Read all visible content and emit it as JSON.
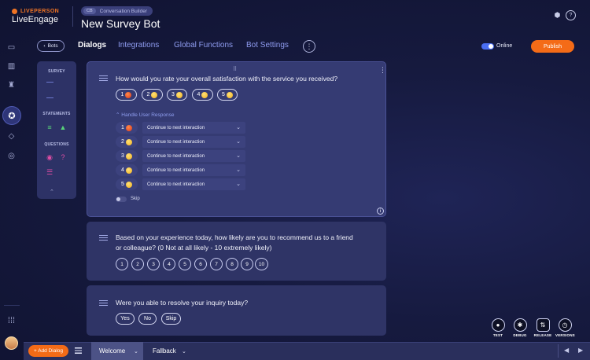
{
  "header": {
    "brand_top": "LIVEPERSON",
    "brand_name": "LiveEngage",
    "crumb_tag": "CB",
    "crumb_text": "Conversation Builder",
    "bot_title": "New Survey Bot"
  },
  "tabs": {
    "bots_label": "Bots",
    "items": [
      "Dialogs",
      "Integrations",
      "Global Functions",
      "Bot Settings"
    ],
    "status_label": "Online",
    "publish_label": "Publish"
  },
  "palette": {
    "sections": [
      "SURVEY",
      "STATEMENTS",
      "QUESTIONS"
    ]
  },
  "questions": [
    {
      "text": "How would you rate your overall satisfaction with the service you received?",
      "options": [
        "1",
        "2",
        "3",
        "4",
        "5"
      ],
      "handle_label": "Handle User Response",
      "responses": [
        {
          "num": "1",
          "action": "Continue to next interaction"
        },
        {
          "num": "2",
          "action": "Continue to next interaction"
        },
        {
          "num": "3",
          "action": "Continue to next interaction"
        },
        {
          "num": "4",
          "action": "Continue to next interaction"
        },
        {
          "num": "5",
          "action": "Continue to next interaction"
        }
      ],
      "skip_label": "Skip"
    },
    {
      "text_line1": "Based on your experience today, how likely are you to recommend us to a friend",
      "text_line2": "or colleague? (0 Not at all likely - 10 extremely likely)",
      "options": [
        "1",
        "2",
        "3",
        "4",
        "5",
        "6",
        "7",
        "8",
        "9",
        "10"
      ]
    },
    {
      "text": "Were you able to resolve your inquiry today?",
      "options": [
        "Yes",
        "No",
        "Skip"
      ]
    }
  ],
  "tools": [
    "TEST",
    "DEBUG",
    "RELEASE",
    "VERSIONS"
  ],
  "bottom": {
    "add_dialog": "+ Add Dialog",
    "dialog_tabs": [
      "Welcome",
      "Fallback"
    ]
  }
}
